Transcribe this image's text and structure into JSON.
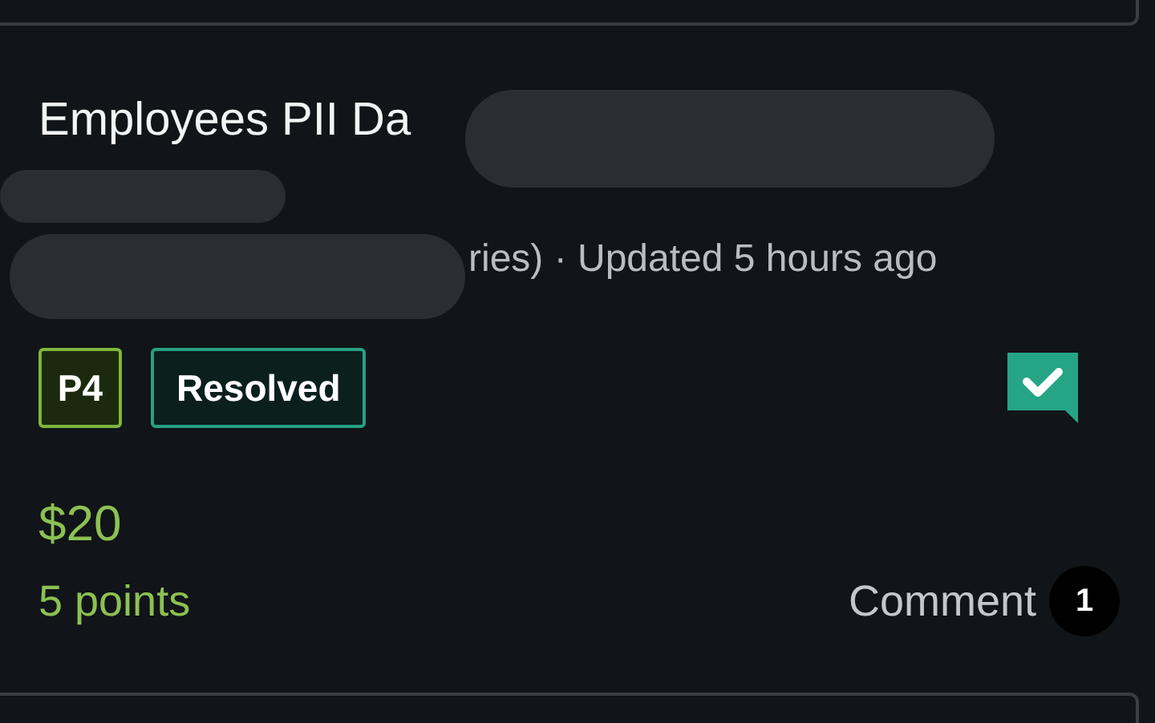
{
  "report": {
    "title": "Employees PII Da",
    "meta": "ries) · Updated 5 hours ago",
    "priority": "P4",
    "status": "Resolved",
    "resolved": true,
    "bounty": "$20",
    "points": "5 points",
    "comment_label": "Comment",
    "comment_count": "1"
  }
}
